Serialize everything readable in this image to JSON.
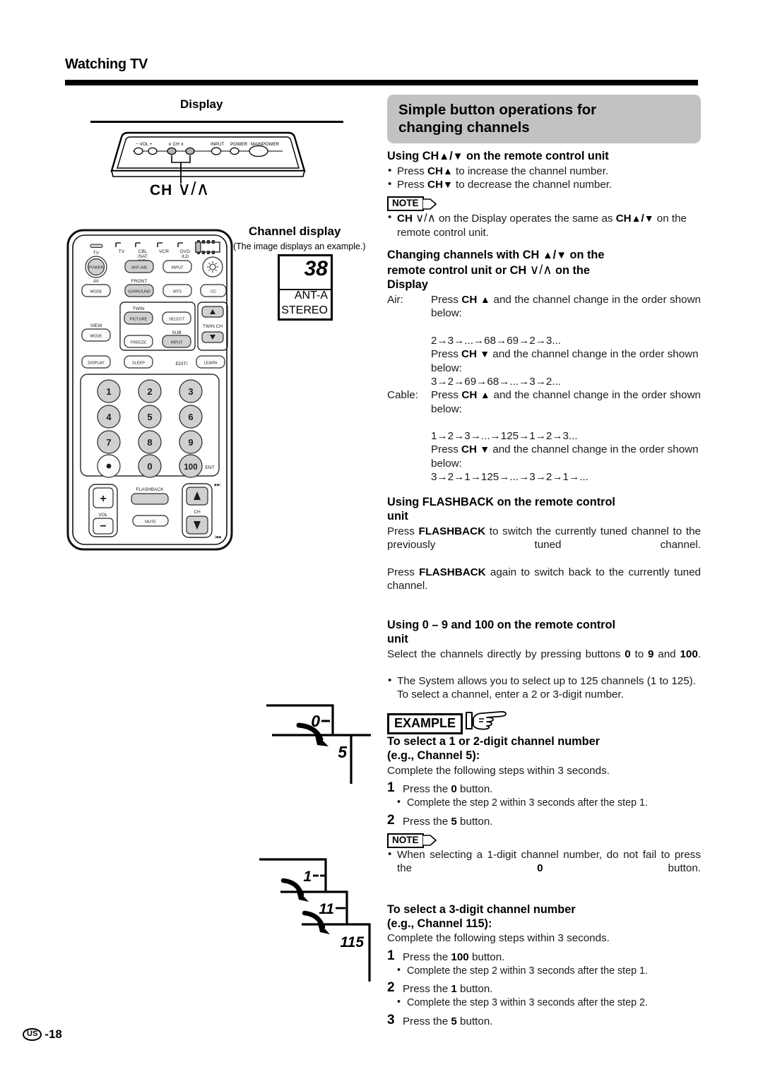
{
  "header": {
    "title": "Watching TV"
  },
  "left": {
    "display_label": "Display",
    "ch_caption_prefix": "CH",
    "ch_caption_symbols": "∨/∧",
    "tv_panel": {
      "labels": [
        "− VOL +",
        "∨ CH ∧",
        "INPUT",
        "POWER",
        "MAINPOWER"
      ]
    },
    "remote": {
      "indicator_labels": [
        "TV",
        "CBL\n/SAT\n/DTV",
        "VCR",
        "DVD\n/LD"
      ],
      "tv_label": "TV",
      "row1": [
        "POWER",
        "ANT-A/B",
        "INPUT",
        "light-icon"
      ],
      "row2_top_labels": [
        "AV",
        "FRONT"
      ],
      "row2": [
        "MODE",
        "SURROUND",
        "MTS",
        "CC"
      ],
      "twin_label": "TWIN",
      "sub_label": "SUB",
      "view_label": "VIEW",
      "twin_ch_label": "TWIN CH",
      "row3": [
        "PICTURE",
        "SELECT"
      ],
      "row4": [
        "MODE",
        "FREEZE",
        "INPUT"
      ],
      "row5": [
        "DISPLAY",
        "SLEEP",
        "LEARN"
      ],
      "edit_label": "EDIT/",
      "keypad": [
        "1",
        "2",
        "3",
        "4",
        "5",
        "6",
        "7",
        "8",
        "9",
        "•",
        "0",
        "100"
      ],
      "ent_label": "ENT",
      "vol_plus": "+",
      "vol_minus": "−",
      "vol_label": "VOL",
      "flashback_label": "FLASHBACK",
      "mute_label": "MUTE",
      "ch_label": "CH"
    },
    "channel_display": {
      "title": "Channel display",
      "subtitle": "(The image displays an example.)",
      "number": "38",
      "line1": "ANT-A",
      "line2": "STEREO"
    },
    "step_diagram_1": {
      "values": [
        "0–",
        "5"
      ]
    },
    "step_diagram_2": {
      "values": [
        "1––",
        "11–",
        "115"
      ]
    }
  },
  "right": {
    "banner_line1": "Simple button operations for",
    "banner_line2": "changing channels",
    "sec1": {
      "heading_pre": "Using CH",
      "heading_mid": "/",
      "heading_post": " on the remote control unit",
      "bullet1_pre": "Press ",
      "bullet1_bold": "CH",
      "bullet1_post": " to increase the channel number.",
      "bullet2_pre": "Press ",
      "bullet2_bold": "CH",
      "bullet2_post": " to decrease the channel number.",
      "note_label": "NOTE",
      "note_bold1": "CH",
      "note_sym": "∨/∧",
      "note_mid": " on the Display operates the same as ",
      "note_bold2": "CH",
      "note_tail": "on the remote control unit."
    },
    "sec2": {
      "heading_l1_a": "Changing channels with CH ",
      "heading_l1_b": " on the",
      "heading_l2_a": "remote control unit or CH ",
      "heading_l2_sym": "∨/∧",
      "heading_l2_b": " on the",
      "heading_l3": "Display",
      "air_key": "Air:",
      "air_line1_pre": "Press ",
      "air_line1_bold": "CH",
      "air_line1_post": " and the channel change in the order shown below:",
      "air_seq_up": "2→3→...→68→69→2→3...",
      "air_line2_pre": "Press ",
      "air_line2_bold": "CH",
      "air_line2_post": " and the channel change in the order shown below:",
      "air_seq_down": "3→2→69→68→...→3→2...",
      "cable_key": "Cable:",
      "cable_line1_pre": "Press ",
      "cable_line1_bold": "CH",
      "cable_line1_post": " and the channel change in the order shown below:",
      "cable_seq_up": "1→2→3→...→125→1→2→3...",
      "cable_line2_pre": "Press ",
      "cable_line2_bold": "CH",
      "cable_line2_post": " and the channel change in the order shown below:",
      "cable_seq_down": "3→2→1→125→...→3→2→1→..."
    },
    "sec3": {
      "heading_l1": "Using FLASHBACK on the remote control",
      "heading_l2": "unit",
      "p1_pre": "Press ",
      "p1_bold": "FLASHBACK",
      "p1_post": " to switch the currently tuned channel to the previously tuned channel.",
      "p2_pre": "Press ",
      "p2_bold": "FLASHBACK",
      "p2_post": " again to switch back to the currently tuned channel."
    },
    "sec4": {
      "heading_l1": "Using 0 – 9 and 100 on the remote control",
      "heading_l2": "unit",
      "p1_a": "Select the channels directly by pressing buttons ",
      "p1_b0": "0",
      "p1_c": " to ",
      "p1_b9": "9",
      "p1_d": " and ",
      "p1_b100": "100",
      "p1_e": ".",
      "bullet1": "The System allows you to select up to 125 channels (1 to 125). To select a channel, enter a 2 or 3-digit number.",
      "example_label": "EXAMPLE",
      "ex1_title_l1": "To select a 1 or 2-digit channel number",
      "ex1_title_l2": "(e.g., Channel 5):",
      "ex1_intro": "Complete the following steps within 3 seconds.",
      "ex1_step1_n": "1",
      "ex1_step1_a": "Press the ",
      "ex1_step1_b": "0",
      "ex1_step1_c": " button.",
      "ex1_step1_sub": "Complete the step 2 within 3 seconds after the step 1.",
      "ex1_step2_n": "2",
      "ex1_step2_a": "Press the ",
      "ex1_step2_b": "5",
      "ex1_step2_c": " button.",
      "note_label": "NOTE",
      "note_a": "When selecting a 1-digit channel number, do not fail to press the ",
      "note_b": "0",
      "note_c": " button.",
      "ex2_title_l1": "To select a 3-digit channel number",
      "ex2_title_l2": "(e.g., Channel 115):",
      "ex2_intro": "Complete the following steps within 3 seconds.",
      "ex2_step1_n": "1",
      "ex2_step1_a": "Press the ",
      "ex2_step1_b": "100",
      "ex2_step1_c": " button.",
      "ex2_step1_sub": "Complete the step 2 within 3 seconds after the step 1.",
      "ex2_step2_n": "2",
      "ex2_step2_a": "Press the ",
      "ex2_step2_b": "1",
      "ex2_step2_c": " button.",
      "ex2_step2_sub": "Complete the step 3 within 3 seconds after the step 2.",
      "ex2_step3_n": "3",
      "ex2_step3_a": "Press the ",
      "ex2_step3_b": "5",
      "ex2_step3_c": " button."
    }
  },
  "footer": {
    "region": "US",
    "page": "-18"
  }
}
